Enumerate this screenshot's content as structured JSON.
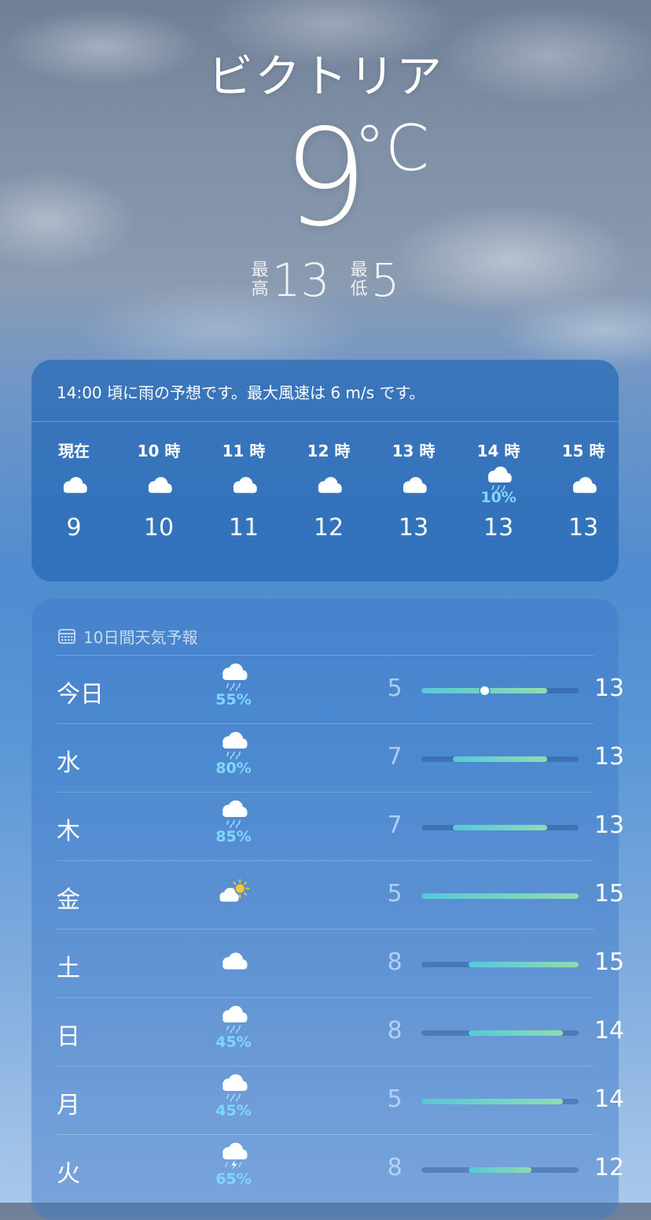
{
  "location": {
    "city": "ビクトリア",
    "temp": "9",
    "unit": "°C",
    "high_label_1": "最",
    "high_label_2": "高",
    "high": "13",
    "low_label_1": "最",
    "low_label_2": "低",
    "low": "5"
  },
  "hourly": {
    "summary": "14:00 頃に雨の予想です。最大風速は 6 m/s です。",
    "items": [
      {
        "time": "現在",
        "icon": "cloud-icon",
        "pct": "",
        "temp": "9"
      },
      {
        "time": "10 時",
        "icon": "cloud-icon",
        "pct": "",
        "temp": "10"
      },
      {
        "time": "11 時",
        "icon": "cloud-icon",
        "pct": "",
        "temp": "11"
      },
      {
        "time": "12 時",
        "icon": "cloud-icon",
        "pct": "",
        "temp": "12"
      },
      {
        "time": "13 時",
        "icon": "cloud-icon",
        "pct": "",
        "temp": "13"
      },
      {
        "time": "14 時",
        "icon": "cloud-rain-icon",
        "pct": "10%",
        "temp": "13"
      },
      {
        "time": "15 時",
        "icon": "cloud-icon",
        "pct": "",
        "temp": "13"
      }
    ]
  },
  "daily": {
    "title": "10日間天気予報",
    "range_min": 5,
    "range_max": 15,
    "rows": [
      {
        "day": "今日",
        "icon": "cloud-rain-icon",
        "pct": "55%",
        "lo": 5,
        "hi": 13,
        "lo_text": "5",
        "hi_text": "13",
        "current": 9
      },
      {
        "day": "水",
        "icon": "cloud-rain-icon",
        "pct": "80%",
        "lo": 7,
        "hi": 13,
        "lo_text": "7",
        "hi_text": "13"
      },
      {
        "day": "木",
        "icon": "cloud-rain-icon",
        "pct": "85%",
        "lo": 7,
        "hi": 13,
        "lo_text": "7",
        "hi_text": "13"
      },
      {
        "day": "金",
        "icon": "partly-sunny-icon",
        "pct": "",
        "lo": 5,
        "hi": 15,
        "lo_text": "5",
        "hi_text": "15"
      },
      {
        "day": "土",
        "icon": "cloud-icon",
        "pct": "",
        "lo": 8,
        "hi": 15,
        "lo_text": "8",
        "hi_text": "15"
      },
      {
        "day": "日",
        "icon": "cloud-rain-icon",
        "pct": "45%",
        "lo": 8,
        "hi": 14,
        "lo_text": "8",
        "hi_text": "14"
      },
      {
        "day": "月",
        "icon": "cloud-rain-icon",
        "pct": "45%",
        "lo": 5,
        "hi": 14,
        "lo_text": "5",
        "hi_text": "14"
      },
      {
        "day": "火",
        "icon": "thunderstorm-icon",
        "pct": "65%",
        "lo": 8,
        "hi": 12,
        "lo_text": "8",
        "hi_text": "12"
      }
    ]
  },
  "colors": {
    "precip": "#7fd6ff",
    "bar_start": "#55c9d8",
    "bar_end": "#8fdcb0"
  }
}
